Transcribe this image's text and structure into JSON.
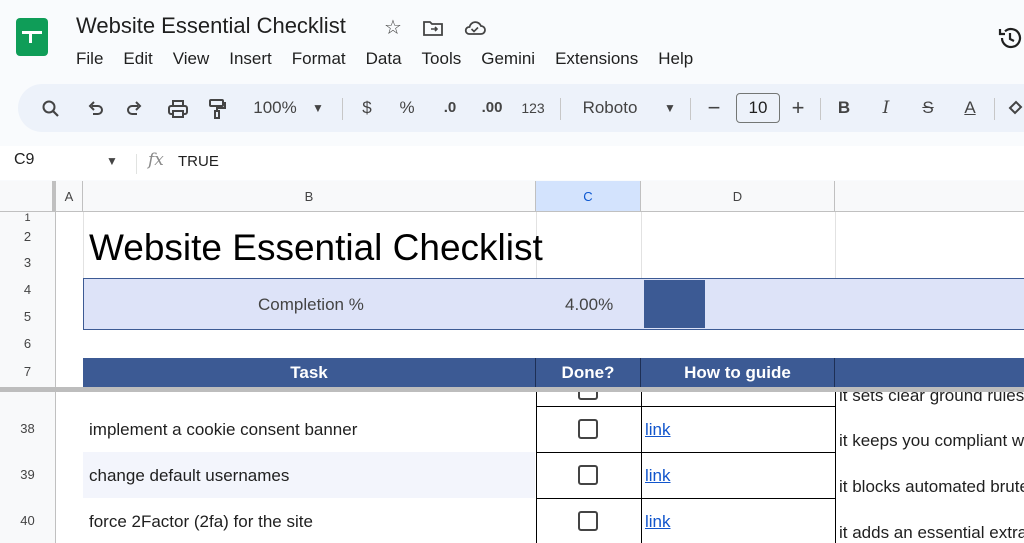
{
  "app": {
    "doc_title": "Website Essential Checklist",
    "menu": [
      "File",
      "Edit",
      "View",
      "Insert",
      "Format",
      "Data",
      "Tools",
      "Gemini",
      "Extensions",
      "Help"
    ]
  },
  "toolbar": {
    "zoom": "100%",
    "currency": "$",
    "percent": "%",
    "decrease_decimals": ".0",
    "increase_decimals": ".00",
    "number_format": "123",
    "font_name": "Roboto",
    "font_size": "10",
    "decrease_font": "−",
    "increase_font": "+",
    "bold": "B",
    "italic": "I",
    "strikethrough": "S",
    "text_color": "A"
  },
  "formula_bar": {
    "name_box": "C9",
    "fx": "fx",
    "value": "TRUE"
  },
  "grid": {
    "columns": [
      "A",
      "B",
      "C",
      "D"
    ],
    "selected_column": "C",
    "rows_top": [
      "1",
      "2",
      "3",
      "4",
      "5",
      "6",
      "7"
    ],
    "rows_body": [
      "38",
      "39",
      "40"
    ]
  },
  "sheet": {
    "title": "Website Essential Checklist",
    "completion_label": "Completion %",
    "completion_value": "4.00%",
    "completion_fraction": 0.04,
    "headers": {
      "task": "Task",
      "done": "Done?",
      "guide": "How to guide"
    },
    "partial_row_desc": "it sets clear ground rules",
    "tasks": [
      {
        "row": "38",
        "task": "implement a cookie consent banner",
        "done": false,
        "link": "link",
        "desc": "it keeps you compliant w"
      },
      {
        "row": "39",
        "task": "change default usernames",
        "done": false,
        "link": "link",
        "desc": "it blocks automated brute"
      },
      {
        "row": "40",
        "task": "force 2Factor (2fa) for the site",
        "done": false,
        "link": "link",
        "desc": "it adds an essential extra"
      }
    ]
  },
  "colors": {
    "header_blue": "#3c5a94",
    "band_light": "#dde3f8",
    "link_blue": "#1155cc",
    "selected_col": "#d3e3fd"
  }
}
